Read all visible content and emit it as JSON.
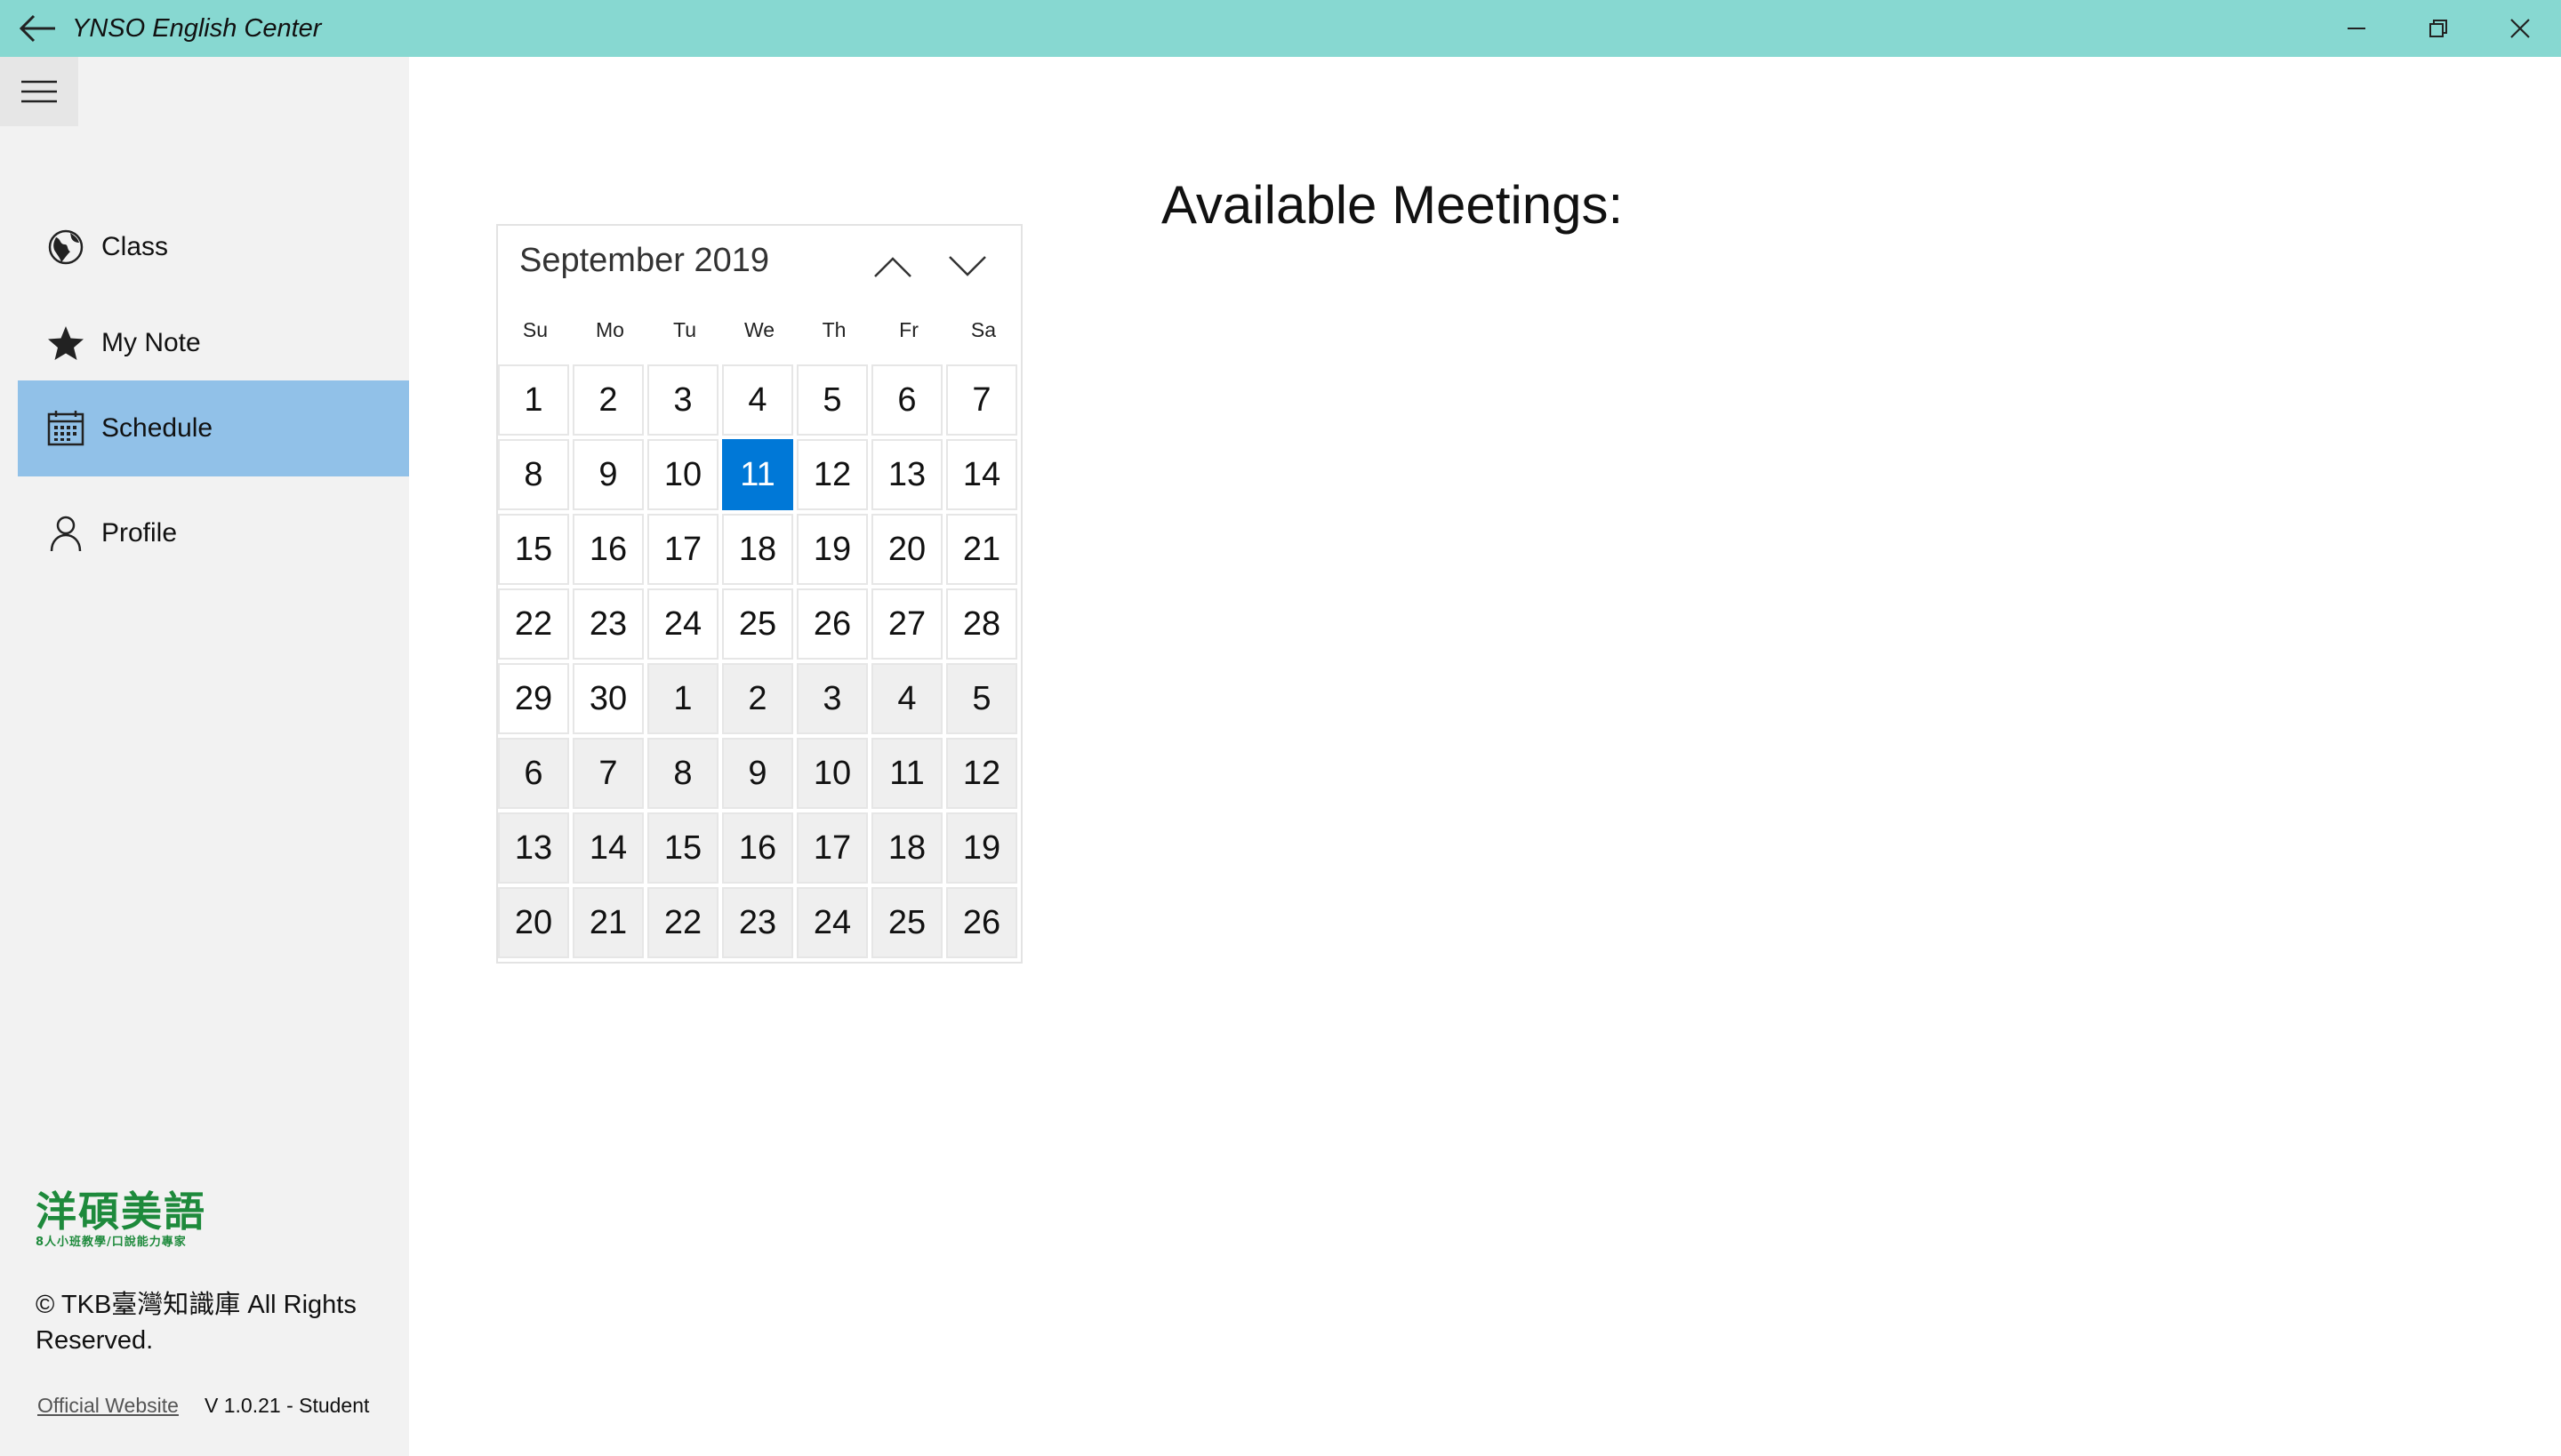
{
  "window": {
    "title": "YNSO English Center",
    "titlebar_color": "#87d8d1"
  },
  "sidebar": {
    "items": [
      {
        "label": "Class",
        "icon": "globe-icon"
      },
      {
        "label": "My Note",
        "icon": "star-icon"
      },
      {
        "label": "Schedule",
        "icon": "calendar-icon",
        "selected": true
      },
      {
        "label": "Profile",
        "icon": "person-icon"
      }
    ],
    "logo": {
      "main": "洋碩美語",
      "sub": "8人小班教學/口說能力專家"
    },
    "copyright": "© TKB臺灣知識庫 All Rights Reserved.",
    "link_label": "Official Website",
    "version": "V 1.0.21 - Student"
  },
  "calendar": {
    "month_label": "September 2019",
    "weekdays": [
      "Su",
      "Mo",
      "Tu",
      "We",
      "Th",
      "Fr",
      "Sa"
    ],
    "selected_date": "11",
    "accent_color": "#0078d7",
    "weeks": [
      [
        "1",
        "2",
        "3",
        "4",
        "5",
        "6",
        "7"
      ],
      [
        "8",
        "9",
        "10",
        "11",
        "12",
        "13",
        "14"
      ],
      [
        "15",
        "16",
        "17",
        "18",
        "19",
        "20",
        "21"
      ],
      [
        "22",
        "23",
        "24",
        "25",
        "26",
        "27",
        "28"
      ],
      [
        "29",
        "30",
        "1",
        "2",
        "3",
        "4",
        "5"
      ],
      [
        "6",
        "7",
        "8",
        "9",
        "10",
        "11",
        "12"
      ],
      [
        "13",
        "14",
        "15",
        "16",
        "17",
        "18",
        "19"
      ],
      [
        "20",
        "21",
        "22",
        "23",
        "24",
        "25",
        "26"
      ]
    ]
  },
  "main": {
    "heading": "Available Meetings:"
  }
}
